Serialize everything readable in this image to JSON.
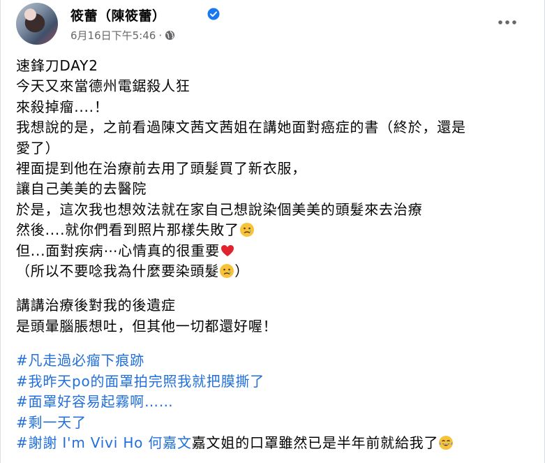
{
  "post": {
    "author": "筱蕾（陳筱蕾）",
    "timestamp": "6月16日下午5:46",
    "separator": "·",
    "privacy_icon": "globe-icon",
    "verified_icon": "verified-badge-icon",
    "more_icon": "more-options-icon"
  },
  "body": {
    "paragraph1": [
      "速鋒刀DAY2",
      "今天又來當德州電鋸殺人狂",
      "來殺掉瘤....！",
      "我想說的是，之前看過陳文茜文茜姐在講她面對癌症的書（終於，還是",
      "愛了）",
      "裡面提到他在治療前去用了頭髮買了新衣服，",
      "讓自己美美的去醫院",
      "於是，這次我也想效法就在家自己想說染個美美的頭髮來去治療",
      "然後....就你們看到照片那樣失敗了",
      "但...面對疾病⋯心情真的很重要",
      "（所以不要唸我為什麼要染頭髮",
      "）"
    ],
    "paragraph2": [
      "講講治療後對我的後遺症",
      "是頭暈腦脹想吐，但其他一切都還好喔！"
    ],
    "hashtags": [
      "#凡走過必瘤下痕跡",
      "#我昨天po的面罩拍完照我就把膜撕了",
      "#面罩好容易起霧啊……",
      "#剩一天了"
    ],
    "last_line": {
      "tag": "#謝謝",
      "mention": " I'm Vivi Ho 何嘉文",
      "text": "嘉文姐的口罩雖然已是半年前就給我了"
    }
  },
  "colors": {
    "text": "#050505",
    "secondary": "#65676b",
    "link": "#216fdb",
    "verified": "#1877f2"
  }
}
